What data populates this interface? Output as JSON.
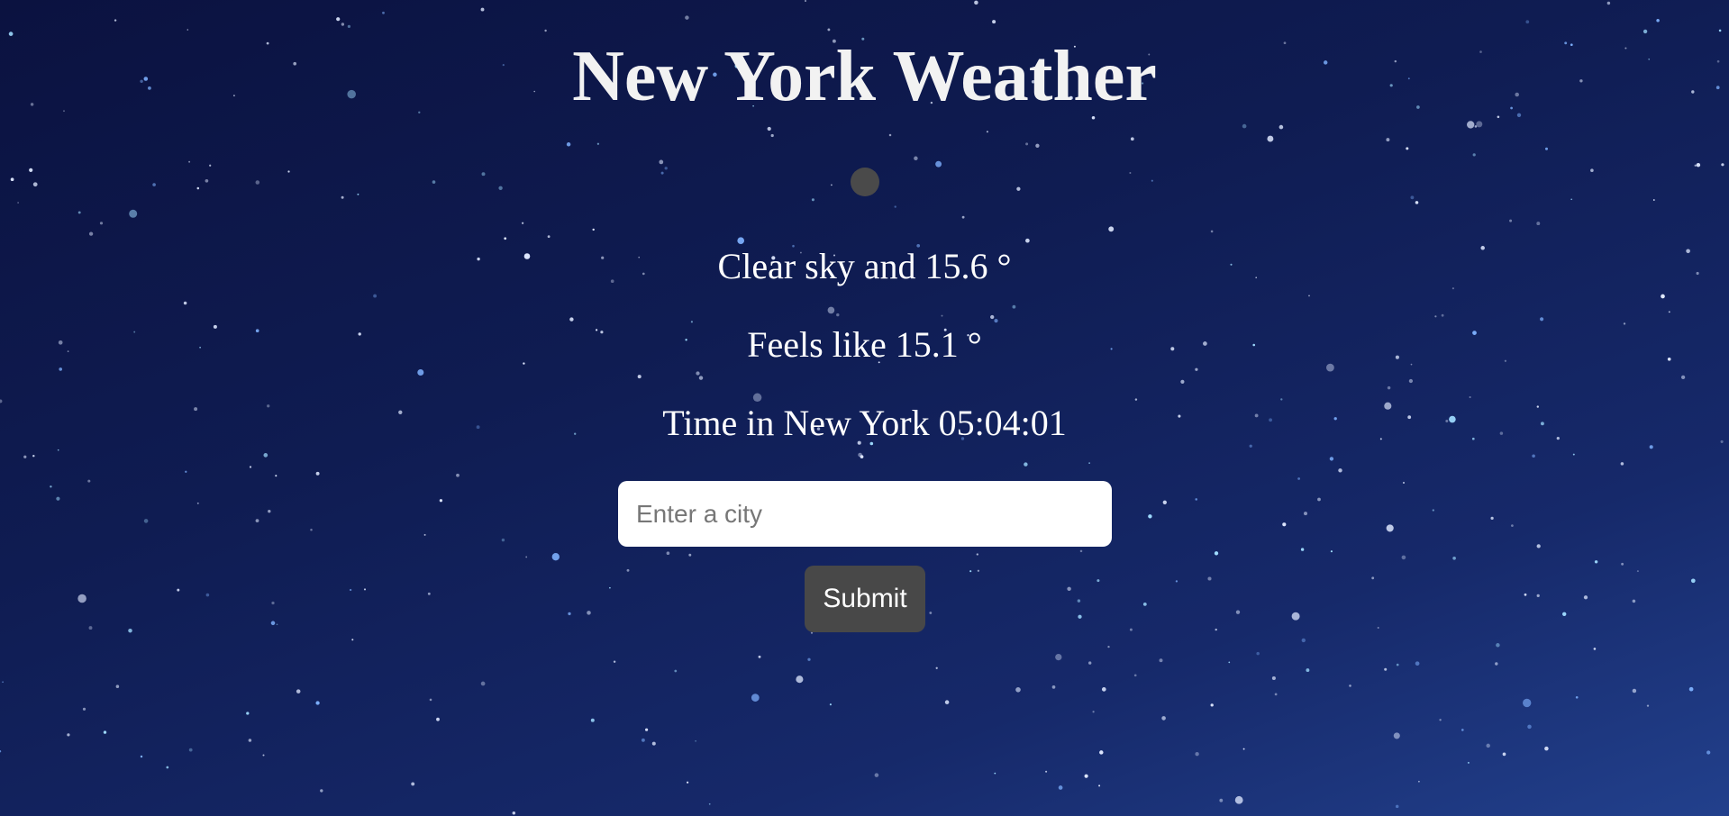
{
  "page": {
    "title": "New York Weather",
    "background": "night-sky-stars"
  },
  "weather": {
    "icon": "weather-condition-icon",
    "description": "Clear sky and 15.6 °",
    "feels_like": "Feels like 15.1 °",
    "local_time": "Time in New York 05:04:01"
  },
  "search": {
    "placeholder": "Enter a city",
    "value": "",
    "submit_label": "Submit"
  },
  "colors": {
    "sky_top": "#0b1240",
    "sky_bottom": "#22408c",
    "icon": "#4a4a4a",
    "button": "#484848",
    "input_background": "#ffffff"
  }
}
